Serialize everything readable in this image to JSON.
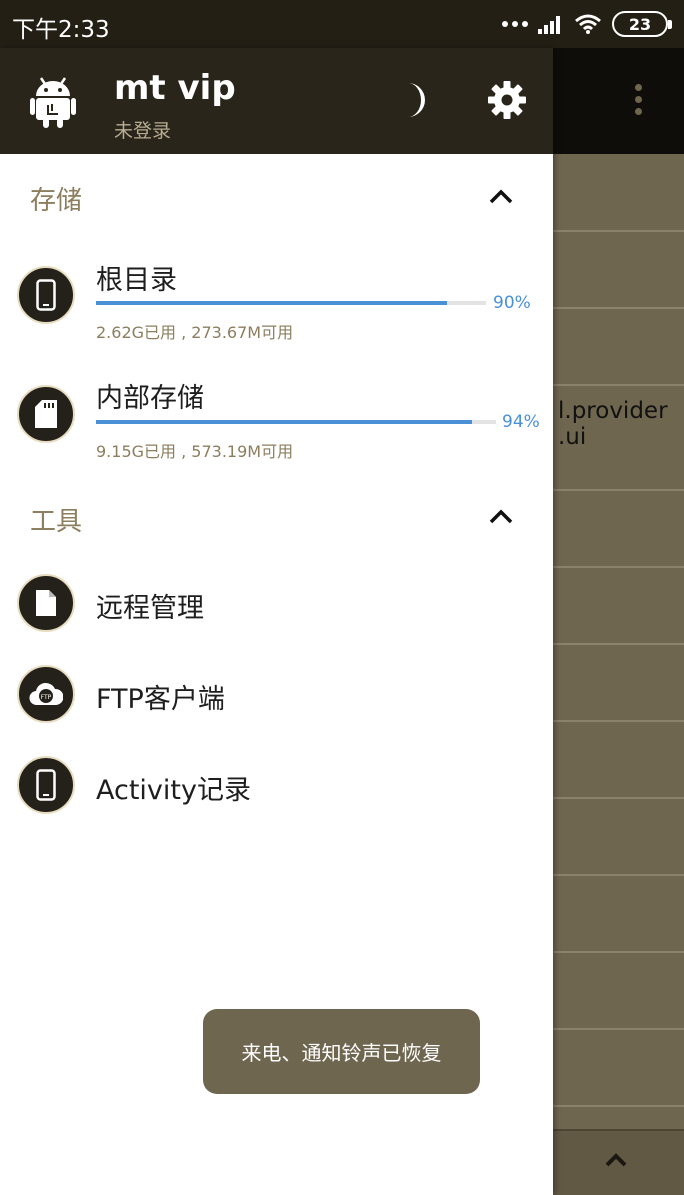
{
  "status_bar": {
    "time": "下午2:33",
    "battery": "23"
  },
  "background_app": {
    "list_text": "l.provider\n.ui"
  },
  "drawer": {
    "header": {
      "title": "mt vip",
      "subtitle": "未登录"
    },
    "storage_section": {
      "title": "存储",
      "items": [
        {
          "name": "根目录",
          "percent": 90,
          "percent_label": "90%",
          "detail": "2.62G已用 , 273.67M可用",
          "icon": "phone-icon"
        },
        {
          "name": "内部存储",
          "percent": 94,
          "percent_label": "94%",
          "detail": "9.15G已用 , 573.19M可用",
          "icon": "sd-card-icon"
        }
      ]
    },
    "tools_section": {
      "title": "工具",
      "items": [
        {
          "label": "远程管理",
          "icon": "file-icon"
        },
        {
          "label": "FTP客户端",
          "icon": "ftp-cloud-icon"
        },
        {
          "label": "Activity记录",
          "icon": "phone-icon"
        }
      ]
    }
  },
  "toast": {
    "message": "来电、通知铃声已恢复"
  },
  "colors": {
    "header_bg": "#2a251a",
    "accent_text": "#8c7e5e",
    "progress": "#4a90d6",
    "icon_bg": "#24211a",
    "background_app": "#6f6650"
  }
}
